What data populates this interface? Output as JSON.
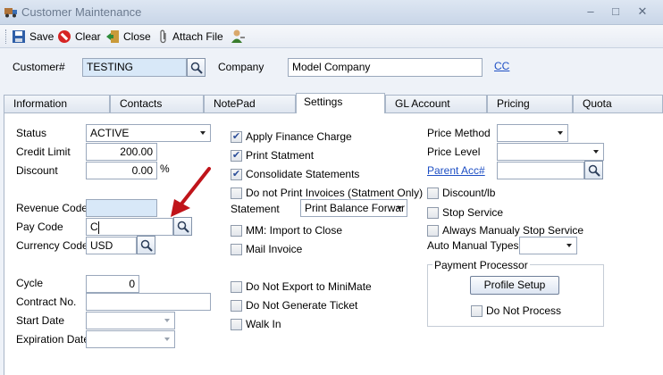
{
  "window": {
    "title": "Customer Maintenance"
  },
  "toolbar": {
    "save": "Save",
    "clear": "Clear",
    "close": "Close",
    "attach": "Attach File"
  },
  "header": {
    "customer_label": "Customer#",
    "customer_value": "TESTING",
    "company_label": "Company",
    "company_value": "Model Company",
    "cc_link": "CC"
  },
  "tabs": [
    {
      "label": "Information"
    },
    {
      "label": "Contacts"
    },
    {
      "label": "NotePad"
    },
    {
      "label": "Settings",
      "active": true
    },
    {
      "label": "GL Account"
    },
    {
      "label": "Pricing"
    },
    {
      "label": "Quota"
    }
  ],
  "left": {
    "status_label": "Status",
    "status_value": "ACTIVE",
    "credit_limit_label": "Credit Limit",
    "credit_limit_value": "200.00",
    "discount_label": "Discount",
    "discount_value": "0.00",
    "discount_unit": "%",
    "revenue_code_label": "Revenue Code",
    "revenue_code_value": "",
    "pay_code_label": "Pay Code",
    "pay_code_value": "C",
    "currency_code_label": "Currency Code",
    "currency_code_value": "USD",
    "cycle_label": "Cycle",
    "cycle_value": "0",
    "contract_label": "Contract No.",
    "contract_value": "",
    "start_date_label": "Start Date",
    "start_date_value": "",
    "expiration_date_label": "Expiration Date",
    "expiration_date_value": ""
  },
  "middle": {
    "apply_finance": {
      "label": "Apply Finance Charge",
      "checked": true
    },
    "print_statement": {
      "label": "Print Statment",
      "checked": true
    },
    "consolidate": {
      "label": "Consolidate Statements",
      "checked": true
    },
    "no_print_invoices": {
      "label": "Do not Print Invoices (Statment Only)",
      "checked": false
    },
    "statement_label": "Statement",
    "statement_value": "Print Balance Forwar",
    "mm_import": {
      "label": "MM:  Import to Close",
      "checked": false
    },
    "mail_invoice": {
      "label": "Mail Invoice",
      "checked": false
    },
    "no_export": {
      "label": "Do Not Export to MiniMate",
      "checked": false
    },
    "no_ticket": {
      "label": "Do Not Generate Ticket",
      "checked": false
    },
    "walk_in": {
      "label": "Walk In",
      "checked": false
    }
  },
  "right": {
    "price_method_label": "Price Method",
    "price_method_value": "",
    "price_level_label": "Price Level",
    "price_level_value": "",
    "parent_acc_label": "Parent Acc#",
    "parent_acc_value": "",
    "discount_lb": {
      "label": "Discount/lb",
      "checked": false
    },
    "stop_service": {
      "label": "Stop Service",
      "checked": false
    },
    "always_manual_stop": {
      "label": "Always Manualy Stop Service",
      "checked": false
    },
    "auto_manual_types_label": "Auto Manual Types",
    "auto_manual_types_value": "",
    "payment_processor_title": "Payment Processor",
    "profile_setup_button": "Profile Setup",
    "do_not_process": {
      "label": "Do Not Process",
      "checked": false
    }
  },
  "colors": {
    "accent_link": "#1e4fc4",
    "annotation_arrow": "#c0141a",
    "field_highlight": "#d8e8f8"
  }
}
